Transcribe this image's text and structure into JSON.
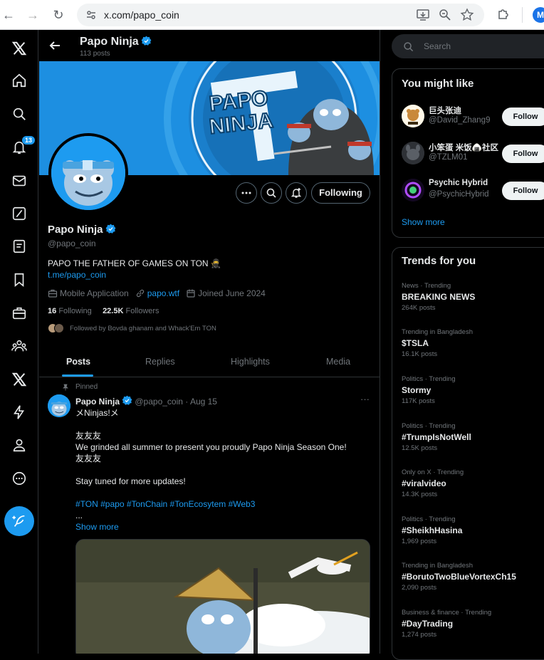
{
  "browser": {
    "url": "x.com/papo_coin",
    "profile_initial": "M"
  },
  "leftnav": {
    "notifications_badge": "13",
    "items": [
      "x-logo-icon",
      "home-icon",
      "search-icon",
      "notifications-icon",
      "messages-icon",
      "grok-icon",
      "lists-icon",
      "bookmarks-icon",
      "jobs-icon",
      "communities-icon",
      "premium-icon",
      "verified-orgs-icon",
      "profile-icon",
      "more-icon"
    ]
  },
  "header": {
    "name": "Papo Ninja",
    "post_count": "113 posts"
  },
  "banner": {
    "text_line1": "PAPO",
    "text_line2": "NINJA"
  },
  "profile": {
    "name": "Papo Ninja",
    "handle": "@papo_coin",
    "bio": "PAPO THE FATHER OF GAMES ON TON 🥷",
    "link": "t.me/papo_coin",
    "category": "Mobile Application",
    "website": "papo.wtf",
    "joined": "Joined June 2024",
    "following_count": "16",
    "following_label": "Following",
    "followers_count": "22.5K",
    "followers_label": "Followers",
    "followed_by": "Followed by Bovda ghanam and Whack'Em TON",
    "following_button": "Following"
  },
  "tabs": [
    "Posts",
    "Replies",
    "Highlights",
    "Media"
  ],
  "post": {
    "pinned_label": "Pinned",
    "author": "Papo Ninja",
    "handle": "@papo_coin",
    "date": "· Aug 15",
    "lines": [
      "メNinjas!メ",
      "",
      "友友友",
      "We grinded all summer to present you proudly Papo Ninja Season One!",
      "友友友",
      "",
      "Stay tuned for more updates!",
      ""
    ],
    "hashtags": "#TON #papo #TonChain #TonEcosytem #Web3",
    "ellipsis": "...",
    "show_more": "Show more"
  },
  "search": {
    "placeholder": "Search"
  },
  "you_might_like": {
    "title": "You might like",
    "users": [
      {
        "name": "巨头张迪",
        "handle": "@David_Zhang9",
        "button": "Follow"
      },
      {
        "name": "小笨蛋 米饭🍙社区",
        "handle": "@TZLM01",
        "button": "Follow"
      },
      {
        "name": "Psychic Hybrid",
        "handle": "@PsychicHybrid",
        "button": "Follow"
      }
    ],
    "show_more": "Show more"
  },
  "trends": {
    "title": "Trends for you",
    "items": [
      {
        "context": "News · Trending",
        "name": "BREAKING NEWS",
        "count": "264K posts"
      },
      {
        "context": "Trending in Bangladesh",
        "name": "$TSLA",
        "count": "16.1K posts"
      },
      {
        "context": "Politics · Trending",
        "name": "Stormy",
        "count": "117K posts"
      },
      {
        "context": "Politics · Trending",
        "name": "#TrumpIsNotWell",
        "count": "12.5K posts"
      },
      {
        "context": "Only on X · Trending",
        "name": "#viralvideo",
        "count": "14.3K posts"
      },
      {
        "context": "Politics · Trending",
        "name": "#SheikhHasina",
        "count": "1,969 posts"
      },
      {
        "context": "Trending in Bangladesh",
        "name": "#BorutoTwoBlueVortexCh15",
        "count": "2,090 posts"
      },
      {
        "context": "Business & finance · Trending",
        "name": "#DayTrading",
        "count": "1,274 posts"
      }
    ]
  }
}
